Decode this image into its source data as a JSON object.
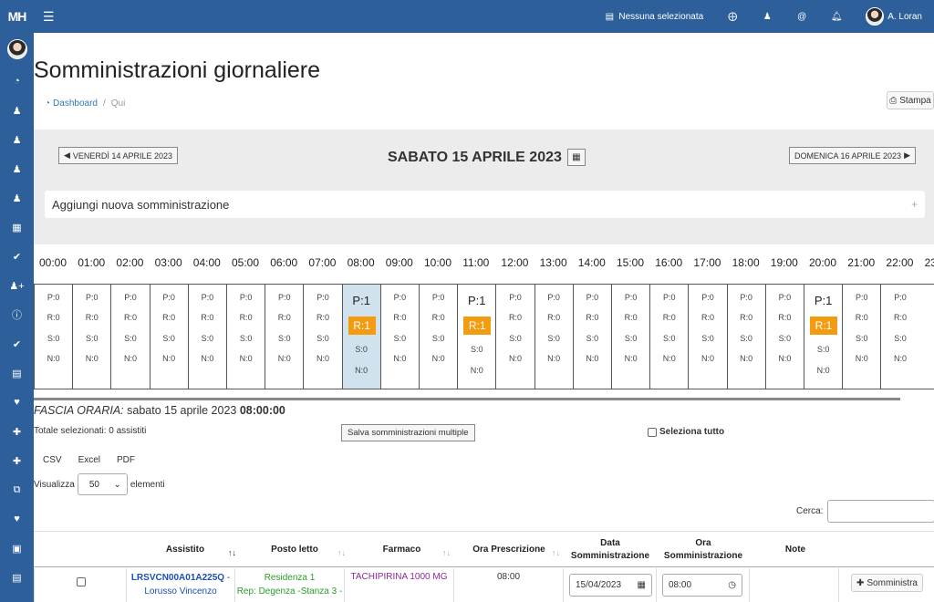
{
  "topbar": {
    "logo": "MH",
    "selection_label": "Nessuna selezionata",
    "user_name": "A. Loran"
  },
  "page": {
    "title": "Somministrazioni giornaliere",
    "breadcrumb_home": "Dashboard",
    "breadcrumb_current": "Qui",
    "print_label": "Stampa"
  },
  "day_nav": {
    "prev_label": "VENERDÌ 14 APRILE 2023",
    "current_label": "SABATO 15 APRILE 2023",
    "next_label": "DOMENICA 16 APRILE 2023"
  },
  "add_panel": {
    "label": "Aggiungi nuova somministrazione",
    "plus": "+"
  },
  "hours": [
    "00:00",
    "01:00",
    "02:00",
    "03:00",
    "04:00",
    "05:00",
    "06:00",
    "07:00",
    "08:00",
    "09:00",
    "10:00",
    "11:00",
    "12:00",
    "13:00",
    "14:00",
    "15:00",
    "16:00",
    "17:00",
    "18:00",
    "19:00",
    "20:00",
    "21:00",
    "22:00",
    "23"
  ],
  "slot_counts": {
    "default": {
      "p": "P:0",
      "r": "R:0",
      "s": "S:0",
      "n": "N:0"
    },
    "active": {
      "p": "P:1",
      "r": "R:1",
      "s": "S:0",
      "n": "N:0"
    }
  },
  "fascia": {
    "prefix": "FASCIA ORARIA:",
    "date": "sabato 15 aprile 2023",
    "time": "08:00:00"
  },
  "totale_label": "Totale selezionati: 0 assistiti",
  "save_multi_label": "Salva somministrazioni multiple",
  "select_all_label": "Seleziona tutto",
  "exports": [
    "CSV",
    "Excel",
    "PDF"
  ],
  "length": {
    "prefix": "Visualizza",
    "value": "50",
    "suffix": "elementi"
  },
  "search": {
    "label": "Cerca:",
    "value": ""
  },
  "table": {
    "headers": {
      "assistito": "Assistito",
      "posto": "Posto letto",
      "farmaco": "Farmaco",
      "ora_presc": "Ora Prescrizione",
      "data_somm_1": "Data",
      "data_somm_2": "Somministrazione",
      "ora_somm_1": "Ora",
      "ora_somm_2": "Somministrazione",
      "note": "Note"
    },
    "row": {
      "code": "LRSVCN00A01A225Q",
      "dash": " -",
      "name": "Lorusso Vincenzo",
      "posto_1": "Residenza 1",
      "posto_2": "Rep: Degenza -Stanza 3 -",
      "farmaco": "TACHIPIRINA 1000 MG",
      "ora_prescrizione": "08:00",
      "data_somministrazione": "15/04/2023",
      "ora_somministrazione": "08:00",
      "action": "Somministra"
    }
  }
}
